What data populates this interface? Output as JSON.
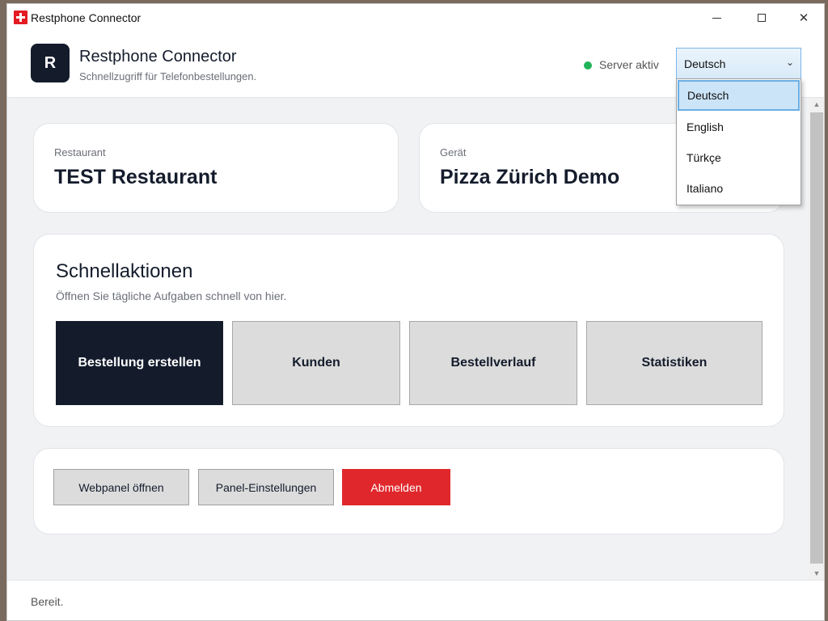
{
  "window": {
    "title": "Restphone Connector",
    "controls": {
      "minimize_icon": "minimize-icon",
      "maximize_icon": "maximize-icon",
      "close_icon": "close-icon"
    }
  },
  "header": {
    "logo_letter": "R",
    "title": "Restphone Connector",
    "subtitle": "Schnellzugriff für Telefonbestellungen.",
    "server_status": "Server aktiv",
    "status_color": "#21b35a",
    "language": {
      "selected": "Deutsch",
      "options": [
        "Deutsch",
        "English",
        "Türkçe",
        "Italiano"
      ]
    }
  },
  "cards": {
    "restaurant": {
      "label": "Restaurant",
      "value": "TEST Restaurant"
    },
    "device": {
      "label": "Gerät",
      "value": "Pizza Zürich Demo"
    }
  },
  "quick_actions": {
    "title": "Schnellaktionen",
    "subtitle": "Öffnen Sie tägliche Aufgaben schnell von hier.",
    "buttons": [
      "Bestellung erstellen",
      "Kunden",
      "Bestellverlauf",
      "Statistiken"
    ]
  },
  "footer_actions": {
    "webpanel": "Webpanel öffnen",
    "settings": "Panel-Einstellungen",
    "logout": "Abmelden"
  },
  "statusbar": {
    "text": "Bereit."
  },
  "colors": {
    "primary": "#141c2c",
    "danger": "#e0282c",
    "swiss_red": "#e31b23"
  }
}
